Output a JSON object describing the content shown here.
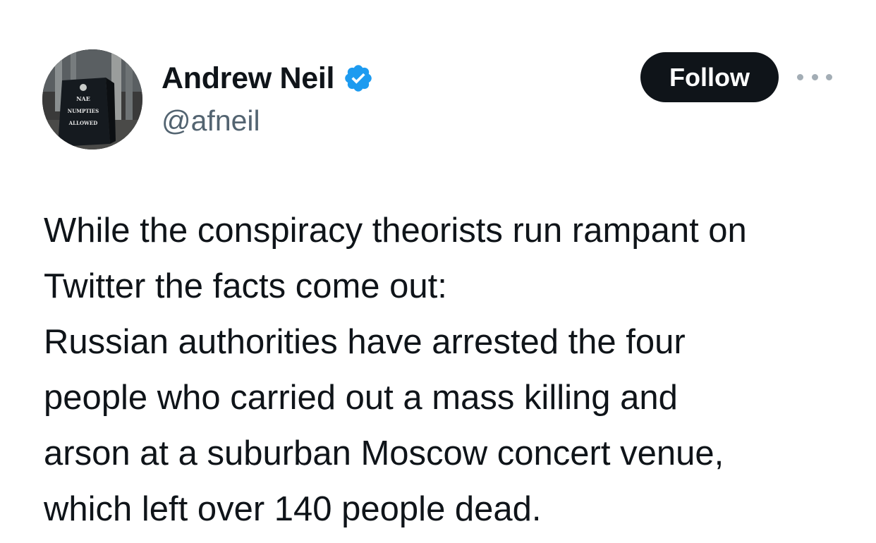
{
  "author": {
    "display_name": "Andrew Neil",
    "handle": "@afneil",
    "verified": true,
    "verified_badge_icon": "verified-badge-icon",
    "avatar_sign_text": [
      "NAE",
      "NUMPTIES",
      "ALLOWED"
    ]
  },
  "actions": {
    "follow_label": "Follow",
    "more_icon": "more-horizontal-icon"
  },
  "tweet": {
    "text": "While the conspiracy theorists run rampant on\nTwitter the facts come out:\nRussian authorities have arrested the four\npeople who carried out a mass killing and\narson at a suburban Moscow concert venue,\nwhich left over 140 people dead."
  },
  "colors": {
    "text_primary": "#0f1419",
    "text_secondary": "#536471",
    "verified_blue": "#1d9bf0",
    "button_dark": "#0f1419"
  }
}
